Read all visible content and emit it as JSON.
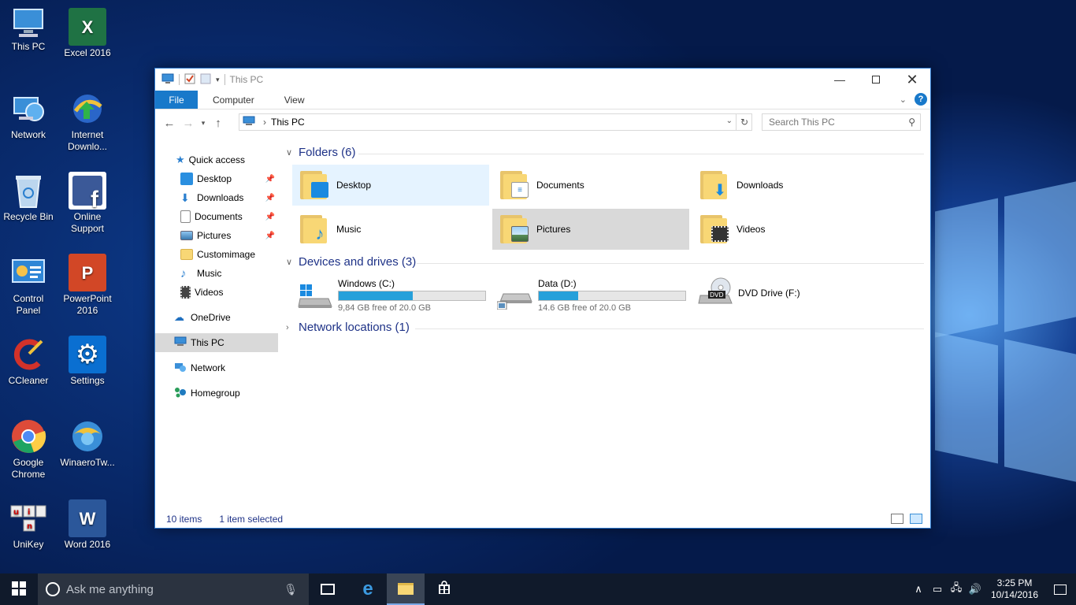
{
  "desktop": {
    "icons": [
      {
        "label": "This PC",
        "color": "#3a8fd8"
      },
      {
        "label": "Excel 2016",
        "color": "#1f7244",
        "glyph": "X"
      },
      {
        "label": "Network",
        "color": "#3a8fd8"
      },
      {
        "label": "Internet Downlo...",
        "color": "#2a9d3a"
      },
      {
        "label": "Recycle Bin",
        "color": "#8fb3d6"
      },
      {
        "label": "Online Support",
        "color": "#3b5998",
        "glyph": "f"
      },
      {
        "label": "Control Panel",
        "color": "#3a8fd8"
      },
      {
        "label": "PowerPoint 2016",
        "color": "#d24726",
        "glyph": "P"
      },
      {
        "label": "CCleaner",
        "color": "#d2322a",
        "glyph": "C"
      },
      {
        "label": "Settings",
        "color": "#0a6fd1",
        "glyph": "⚙"
      },
      {
        "label": "Google Chrome",
        "color": "#dd4b39"
      },
      {
        "label": "WinaeroTw...",
        "color": "#3a8fd8"
      },
      {
        "label": "UniKey",
        "color": "#eeeeee",
        "glyph": "u"
      },
      {
        "label": "Word 2016",
        "color": "#2b579a",
        "glyph": "W"
      }
    ]
  },
  "window": {
    "title": "This PC",
    "tabs": {
      "file": "File",
      "computer": "Computer",
      "view": "View"
    },
    "address": {
      "path": "This PC"
    },
    "search": {
      "placeholder": "Search This PC"
    },
    "nav": {
      "quick_access": "Quick access",
      "desktop": "Desktop",
      "downloads": "Downloads",
      "documents": "Documents",
      "pictures": "Pictures",
      "customimage": "Customimage",
      "music": "Music",
      "videos": "Videos",
      "onedrive": "OneDrive",
      "thispc": "This PC",
      "network": "Network",
      "homegroup": "Homegroup"
    },
    "groups": {
      "folders": "Folders (6)",
      "devices": "Devices and drives (3)",
      "network": "Network locations (1)"
    },
    "folders": [
      {
        "name": "Desktop"
      },
      {
        "name": "Documents"
      },
      {
        "name": "Downloads"
      },
      {
        "name": "Music"
      },
      {
        "name": "Pictures"
      },
      {
        "name": "Videos"
      }
    ],
    "drives": [
      {
        "name": "Windows (C:)",
        "free": "9,84 GB free of 20.0 GB",
        "used_fraction": 0.508
      },
      {
        "name": "Data (D:)",
        "free": "14.6 GB free of 20.0 GB",
        "used_fraction": 0.27
      },
      {
        "name": "DVD Drive (F:)"
      }
    ],
    "status": {
      "items": "10 items",
      "selected": "1 item selected"
    }
  },
  "taskbar": {
    "search_placeholder": "Ask me anything",
    "time": "3:25 PM",
    "date": "10/14/2016"
  },
  "colors": {
    "accent": "#1979ca",
    "group_header": "#1e3287",
    "drive_fill": "#26a0da"
  }
}
